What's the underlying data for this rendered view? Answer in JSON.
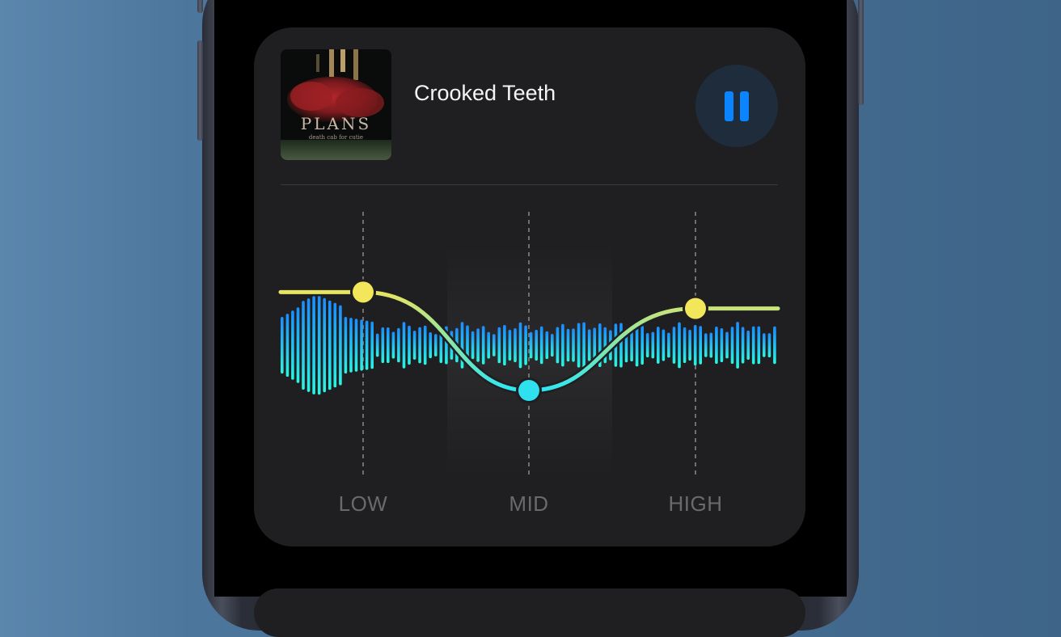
{
  "now_playing": {
    "track_title": "Crooked Teeth",
    "album_art": {
      "title": "PLANS",
      "artist": "death cab for cutie"
    },
    "pause_icon": "pause-icon"
  },
  "equalizer": {
    "band_labels": [
      "LOW",
      "MID",
      "HIGH"
    ],
    "handle_levels": [
      0.78,
      0.0,
      0.65
    ],
    "handle_colors": [
      "#f2e75a",
      "#2fe0ee",
      "#f2e75a"
    ],
    "curve_gradient": [
      "#f0e45a",
      "#2fe6f0"
    ],
    "waveform_gradient": [
      "#2af5e2",
      "#1a8dff"
    ],
    "accent": "#0a84ff"
  }
}
